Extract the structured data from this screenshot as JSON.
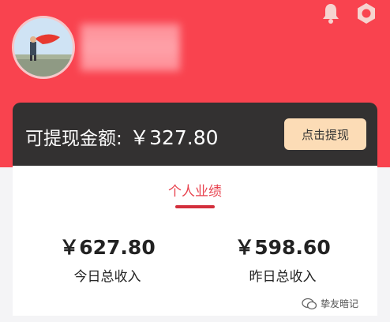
{
  "header": {
    "icons": [
      "bell-icon",
      "gear-icon"
    ],
    "background": "#f9434f"
  },
  "balance": {
    "label": "可提现金额:",
    "amount": "￥327.80",
    "withdraw_label": "点击提现"
  },
  "performance": {
    "tab_label": "个人业绩",
    "today_value": "￥627.80",
    "today_label": "今日总收入",
    "yesterday_value": "￥598.60",
    "yesterday_label": "昨日总收入"
  },
  "watermark": {
    "text": "挚友暗记"
  },
  "colors": {
    "accent": "#f9434f",
    "dark_bar": "#333131",
    "withdraw_button": "#fcdcb6",
    "tab_active": "#e8434f"
  }
}
